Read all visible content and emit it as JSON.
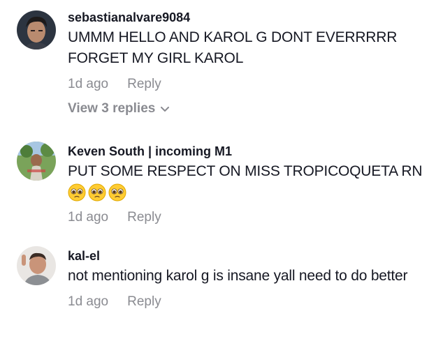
{
  "comments": [
    {
      "username": "sebastianalvare9084",
      "text": "UMMM HELLO AND KAROL G DONT EVERRRRR FORGET MY GIRL KAROL",
      "time": "1d ago",
      "reply_label": "Reply",
      "view_replies_label": "View 3 replies"
    },
    {
      "username": "Keven South | incoming M1",
      "text": "PUT SOME RESPECT ON MISS TROPICOQUETA RN",
      "emojis": [
        "pleading-face-emoji",
        "pleading-face-emoji",
        "pleading-face-emoji"
      ],
      "time": "1d ago",
      "reply_label": "Reply"
    },
    {
      "username": "kal-el",
      "text": "not mentioning karol g is insane yall need to do better",
      "time": "1d ago",
      "reply_label": "Reply"
    }
  ],
  "colors": {
    "primary_text": "#161823",
    "secondary_text": "#8a8b91",
    "background": "#ffffff"
  },
  "icons": {
    "view_replies": "chevron-down-icon"
  }
}
